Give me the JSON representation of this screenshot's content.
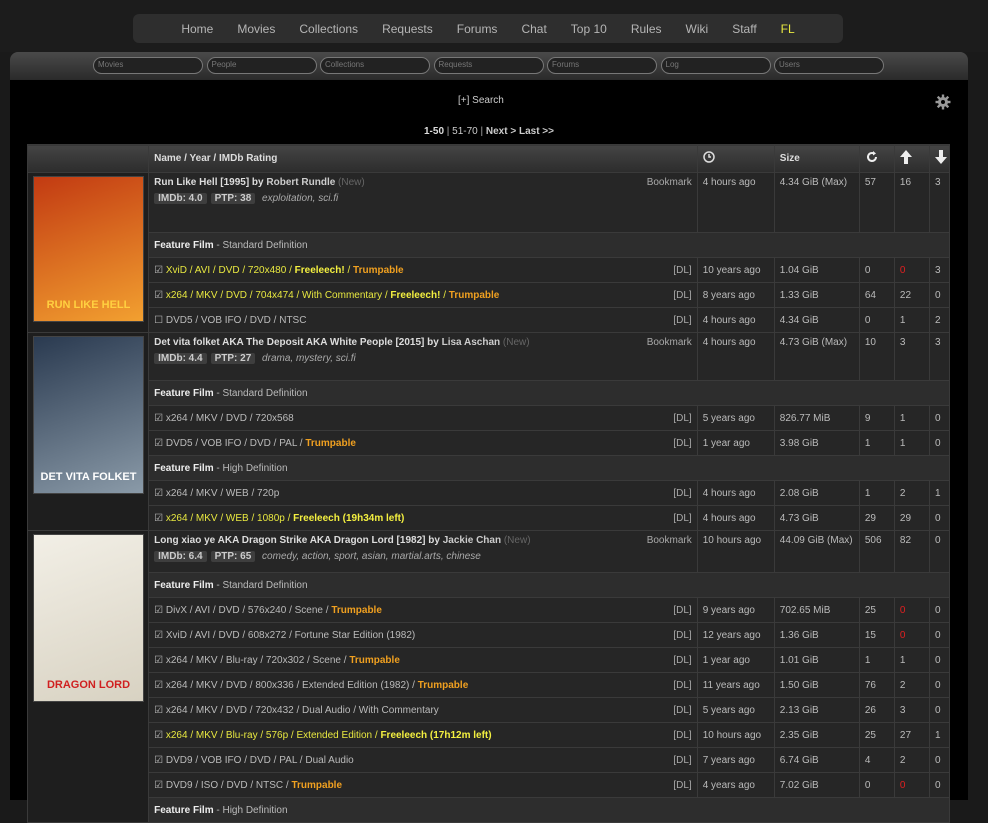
{
  "nav": [
    "Home",
    "Movies",
    "Collections",
    "Requests",
    "Forums",
    "Chat",
    "Top 10",
    "Rules",
    "Wiki",
    "Staff",
    "FL"
  ],
  "search_fields": [
    "Movies",
    "People",
    "Collections",
    "Requests",
    "Forums",
    "Log",
    "Users"
  ],
  "search_link": "[+] Search",
  "pager": {
    "current": "1-50",
    "sep1": " | ",
    "next_range": "51-70",
    "sep2": " | ",
    "next": "Next >",
    "space": " ",
    "last": "Last >>"
  },
  "headers": {
    "name": "Name / Year / IMDb Rating",
    "size": "Size"
  },
  "colors": {
    "freeleech": "#e8e840",
    "trumpable": "#f0a020",
    "zero_seed": "#e02020"
  },
  "groups": [
    {
      "title": "Run Like Hell [1995]",
      "by": " by ",
      "director": "Robert Rundle",
      "new": " (New)",
      "bookmark": "Bookmark",
      "imdb": "IMDb: 4.0",
      "ptp": "PTP: 38",
      "tags": "exploitation, sci.fi",
      "time": "4 hours ago",
      "size": "4.34 GiB (Max)",
      "snatches": "57",
      "seeders": "16",
      "leechers": "3",
      "poster_text": "RUN LIKE HELL",
      "sections": [
        {
          "label": "Feature Film",
          "res": " - Standard Definition",
          "torrents": [
            {
              "chk": "☑ ",
              "prefix": "",
              "title": "XviD / AVI / DVD / 720x480 / ",
              "fl": "Freeleech!",
              "sep": " / ",
              "tr": "Trumpable",
              "freel": true,
              "time": "10 years ago",
              "size": "1.04 GiB",
              "snatches": "0",
              "seeders": "0",
              "leechers": "3",
              "red": true
            },
            {
              "chk": "☑ ",
              "prefix": "",
              "title": "x264 / MKV / DVD / 704x474 / With Commentary / ",
              "fl": "Freeleech!",
              "sep": " / ",
              "tr": "Trumpable",
              "freel": true,
              "time": "8 years ago",
              "size": "1.33 GiB",
              "snatches": "64",
              "seeders": "22",
              "leechers": "0"
            },
            {
              "chk": "☐ ",
              "prefix": "",
              "title": "DVD5 / VOB IFO / DVD / NTSC",
              "fl": "",
              "sep": "",
              "tr": "",
              "time": "4 hours ago",
              "size": "4.34 GiB",
              "snatches": "0",
              "seeders": "1",
              "leechers": "2"
            }
          ]
        }
      ]
    },
    {
      "title": "Det vita folket AKA The Deposit AKA White People [2015]",
      "by": " by ",
      "director": "Lisa Aschan",
      "new": " (New)",
      "bookmark": "Bookmark",
      "imdb": "IMDb: 4.4",
      "ptp": "PTP: 27",
      "tags": "drama, mystery, sci.fi",
      "time": "4 hours ago",
      "size": "4.73 GiB (Max)",
      "snatches": "10",
      "seeders": "3",
      "leechers": "3",
      "poster_text": "DET VITA FOLKET",
      "sections": [
        {
          "label": "Feature Film",
          "res": " - Standard Definition",
          "torrents": [
            {
              "chk": "☑ ",
              "prefix": "",
              "title": "x264 / MKV / DVD / 720x568",
              "fl": "",
              "sep": "",
              "tr": "",
              "time": "5 years ago",
              "size": "826.77 MiB",
              "snatches": "9",
              "seeders": "1",
              "leechers": "0"
            },
            {
              "chk": "☑ ",
              "prefix": "",
              "title": "DVD5 / VOB IFO / DVD / PAL / ",
              "fl": "",
              "sep": "",
              "tr": "Trumpable",
              "time": "1 year ago",
              "size": "3.98 GiB",
              "snatches": "1",
              "seeders": "1",
              "leechers": "0"
            }
          ]
        },
        {
          "label": "Feature Film",
          "res": " - High Definition",
          "torrents": [
            {
              "chk": "☑ ",
              "prefix": "",
              "title": "x264 / MKV / WEB / 720p",
              "fl": "",
              "sep": "",
              "tr": "",
              "time": "4 hours ago",
              "size": "2.08 GiB",
              "snatches": "1",
              "seeders": "2",
              "leechers": "1"
            },
            {
              "chk": "☑ ",
              "prefix": "",
              "title": "x264 / MKV / WEB / 1080p / ",
              "fl": "Freeleech (19h34m left)",
              "sep": "",
              "tr": "",
              "freel": true,
              "time": "4 hours ago",
              "size": "4.73 GiB",
              "snatches": "29",
              "seeders": "29",
              "leechers": "0"
            }
          ]
        }
      ]
    },
    {
      "title": "Long xiao ye AKA Dragon Strike AKA Dragon Lord [1982]",
      "by": " by ",
      "director": "Jackie Chan",
      "new": " (New)",
      "bookmark": "Bookmark",
      "imdb": "IMDb: 6.4",
      "ptp": "PTP: 65",
      "tags": "comedy, action, sport, asian, martial.arts, chinese",
      "time": "10 hours ago",
      "size": "44.09 GiB (Max)",
      "snatches": "506",
      "seeders": "82",
      "leechers": "0",
      "poster_text": "DRAGON LORD",
      "sections": [
        {
          "label": "Feature Film",
          "res": " - Standard Definition",
          "torrents": [
            {
              "chk": "☑ ",
              "prefix": "",
              "title": "DivX / AVI / DVD / 576x240 / Scene / ",
              "fl": "",
              "sep": "",
              "tr": "Trumpable",
              "time": "9 years ago",
              "size": "702.65 MiB",
              "snatches": "25",
              "seeders": "0",
              "leechers": "0",
              "red": true
            },
            {
              "chk": "☑ ",
              "prefix": "",
              "title": "XviD / AVI / DVD / 608x272 / Fortune Star Edition (1982)",
              "fl": "",
              "sep": "",
              "tr": "",
              "time": "12 years ago",
              "size": "1.36 GiB",
              "snatches": "15",
              "seeders": "0",
              "leechers": "0",
              "red": true
            },
            {
              "chk": "☑ ",
              "prefix": "",
              "title": "x264 / MKV / Blu-ray / 720x302 / Scene / ",
              "fl": "",
              "sep": "",
              "tr": "Trumpable",
              "time": "1 year ago",
              "size": "1.01 GiB",
              "snatches": "1",
              "seeders": "1",
              "leechers": "0"
            },
            {
              "chk": "☑ ",
              "prefix": "",
              "title": "x264 / MKV / DVD / 800x336 / Extended Edition (1982) / ",
              "fl": "",
              "sep": "",
              "tr": "Trumpable",
              "time": "11 years ago",
              "size": "1.50 GiB",
              "snatches": "76",
              "seeders": "2",
              "leechers": "0"
            },
            {
              "chk": "☑ ",
              "prefix": "",
              "title": "x264 / MKV / DVD / 720x432 / Dual Audio / With Commentary",
              "fl": "",
              "sep": "",
              "tr": "",
              "time": "5 years ago",
              "size": "2.13 GiB",
              "snatches": "26",
              "seeders": "3",
              "leechers": "0"
            },
            {
              "chk": "☑ ",
              "prefix": "",
              "title": "x264 / MKV / Blu-ray / 576p / Extended Edition / ",
              "fl": "Freeleech (17h12m left)",
              "sep": "",
              "tr": "",
              "freel": true,
              "time": "10 hours ago",
              "size": "2.35 GiB",
              "snatches": "25",
              "seeders": "27",
              "leechers": "1"
            },
            {
              "chk": "☑ ",
              "prefix": "",
              "title": "DVD9 / VOB IFO / DVD / PAL / Dual Audio",
              "fl": "",
              "sep": "",
              "tr": "",
              "time": "7 years ago",
              "size": "6.74 GiB",
              "snatches": "4",
              "seeders": "2",
              "leechers": "0"
            },
            {
              "chk": "☑ ",
              "prefix": "",
              "title": "DVD9 / ISO / DVD / NTSC / ",
              "fl": "",
              "sep": "",
              "tr": "Trumpable",
              "time": "4 years ago",
              "size": "7.02 GiB",
              "snatches": "0",
              "seeders": "0",
              "leechers": "0",
              "red": true
            }
          ]
        },
        {
          "label": "Feature Film",
          "res": " - High Definition",
          "torrents": []
        }
      ]
    }
  ],
  "dl": "[DL]"
}
